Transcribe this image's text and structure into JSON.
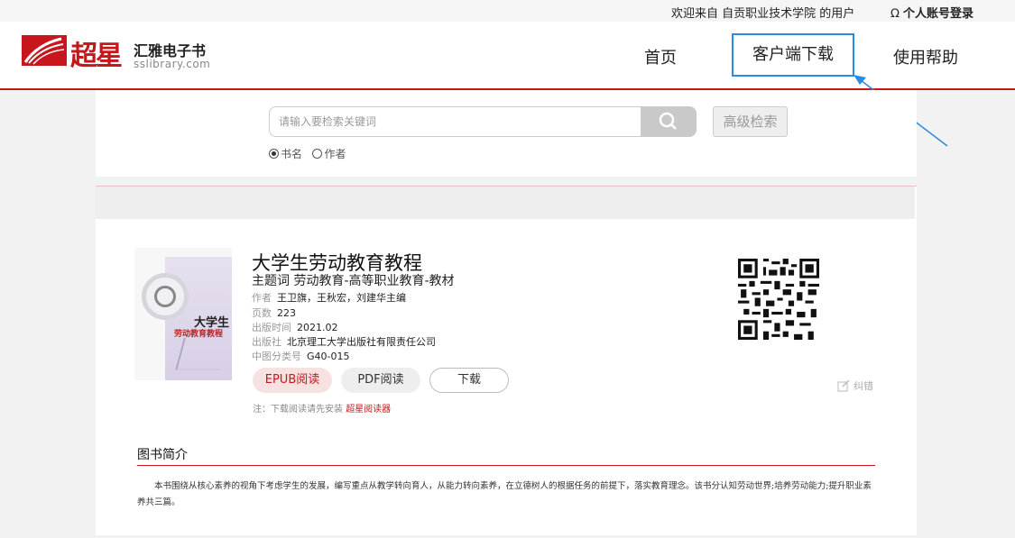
{
  "topbar": {
    "welcome": "欢迎来自 自贡职业技术学院 的用户",
    "login_icon": "user-icon",
    "login": "个人账号登录"
  },
  "header": {
    "logo_mark": "超星",
    "brand_cn": "汇雅电子书",
    "brand_en": "sslibrary.com",
    "nav": {
      "home": "首页",
      "download": "客户端下载",
      "help": "使用帮助"
    },
    "accent_color": "#c8161d",
    "highlight_color": "#2a8be0"
  },
  "search": {
    "placeholder": "请输入要检索关键词",
    "button_icon": "search-icon",
    "advanced": "高级检索",
    "options": [
      "书名",
      "作者"
    ],
    "selected": "书名"
  },
  "book": {
    "title": "大学生劳动教育教程",
    "subject_label": "主题词",
    "subject": "劳动教育-高等职业教育-教材",
    "author_label": "作者",
    "author": "王卫旗，王秋宏，刘建华主编",
    "pages_label": "页数",
    "pages": "223",
    "date_label": "出版时间",
    "date": "2021.02",
    "publisher_label": "出版社",
    "publisher": "北京理工大学出版社有限责任公司",
    "class_label": "中图分类号",
    "class": "G40-015",
    "cover_title_1": "大学生",
    "cover_title_2": "劳动教育教程"
  },
  "actions": {
    "epub": "EPUB阅读",
    "pdf": "PDF阅读",
    "download": "下载",
    "note_prefix": "注：下载阅读请先安装",
    "note_link": "超星阅读器",
    "report": "纠错",
    "report_icon": "edit-icon"
  },
  "intro": {
    "title": "图书简介",
    "text": "本书围绕从核心素养的视角下考虑学生的发展，编写重点从教学转向育人，从能力转向素养，在立德树人的根据任务的前提下，落实教育理念。该书分认知劳动世界;培养劳动能力;提升职业素养共三篇。"
  }
}
